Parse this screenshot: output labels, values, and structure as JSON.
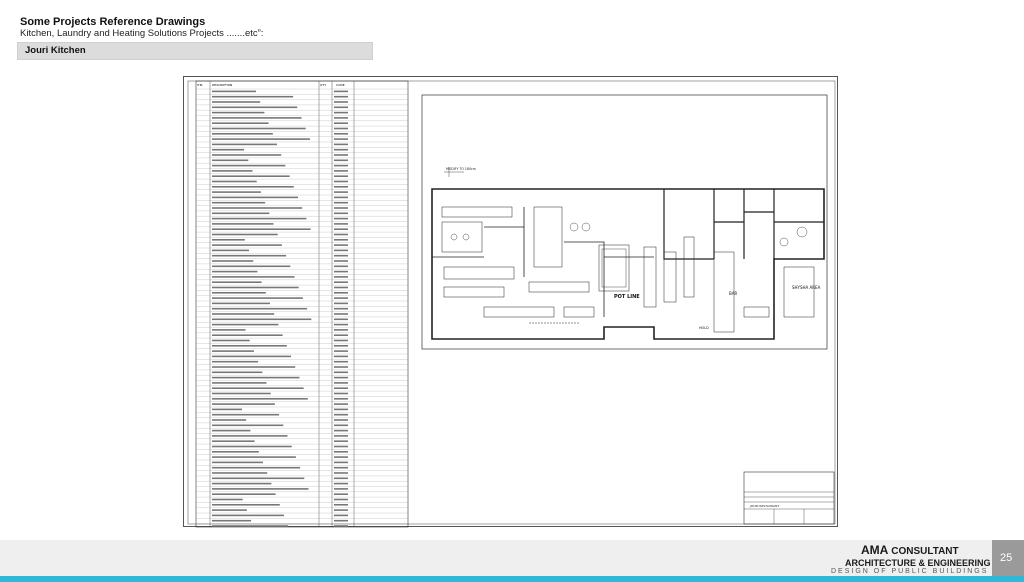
{
  "header": {
    "title": "Some Projects Reference Drawings",
    "subtitle": "Kitchen, Laundry and Heating Solutions Projects .......etc”:"
  },
  "section": {
    "label": "Jouri Kitchen"
  },
  "drawing": {
    "legend_headers": [
      "ITM.",
      "DESCRIPTION",
      "QTY.",
      "CODE"
    ],
    "plan_labels": {
      "modify": "MODIFY TO 180cm",
      "pot_line": "POT LINE",
      "bar": "BAR",
      "shysha": "SHYSHA AREA",
      "hold": "HOLD"
    },
    "title_block": {
      "project": "JOURI RESTAURANT"
    }
  },
  "footer": {
    "brand_bold": "AMA",
    "brand_rest": "CONSULTANT",
    "line2": "ARCHITECTURE & ENGINEERING",
    "line3": "DESIGN OF PUBLIC BUILDINGS",
    "page_number": "25"
  },
  "colors": {
    "accent": "#2fb8d8",
    "page_box": "#9a9a9a",
    "section_bar": "#dcdcdc"
  }
}
